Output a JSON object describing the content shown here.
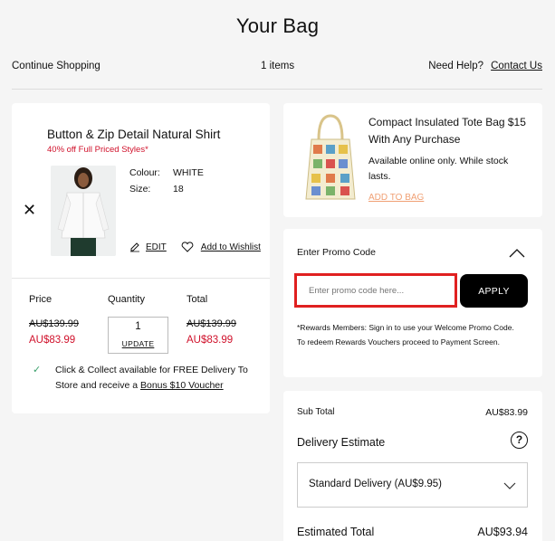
{
  "page": {
    "title": "Your Bag"
  },
  "topbar": {
    "continue_label": "Continue Shopping",
    "item_count": "1 items",
    "help_label": "Need Help?",
    "contact_label": "Contact Us"
  },
  "item": {
    "name": "Button & Zip Detail Natural Shirt",
    "promo": "40% off Full Priced Styles*",
    "colour_label": "Colour:",
    "colour_value": "WHITE",
    "size_label": "Size:",
    "size_value": "18",
    "edit_label": "EDIT",
    "wishlist_label": "Add to Wishlist",
    "price_header": "Price",
    "quantity_header": "Quantity",
    "total_header": "Total",
    "price_original": "AU$139.99",
    "price_sale": "AU$83.99",
    "quantity": "1",
    "update_label": "UPDATE",
    "total_original": "AU$139.99",
    "total_sale": "AU$83.99",
    "click_collect_text": "Click & Collect available for FREE Delivery To Store and receive a",
    "click_collect_link": "Bonus $10 Voucher"
  },
  "offer": {
    "title": "Compact Insulated Tote Bag $15 With Any Purchase",
    "subtitle": "Available online only. While stock lasts.",
    "add_label": "ADD TO BAG"
  },
  "promo": {
    "heading": "Enter Promo Code",
    "placeholder": "Enter promo code here...",
    "apply_label": "APPLY",
    "note": "*Rewards Members: Sign in to use your Welcome Promo Code. To redeem Rewards Vouchers proceed to Payment Screen."
  },
  "summary": {
    "subtotal_label": "Sub Total",
    "subtotal_value": "AU$83.99",
    "delivery_heading": "Delivery Estimate",
    "delivery_option": "Standard Delivery (AU$9.95)",
    "estimated_label": "Estimated Total",
    "estimated_value": "AU$93.94"
  },
  "colors": {
    "sale_red": "#d0112b",
    "highlight": "#e02020",
    "link_orange": "#f0a074",
    "check_green": "#3aa06b"
  }
}
